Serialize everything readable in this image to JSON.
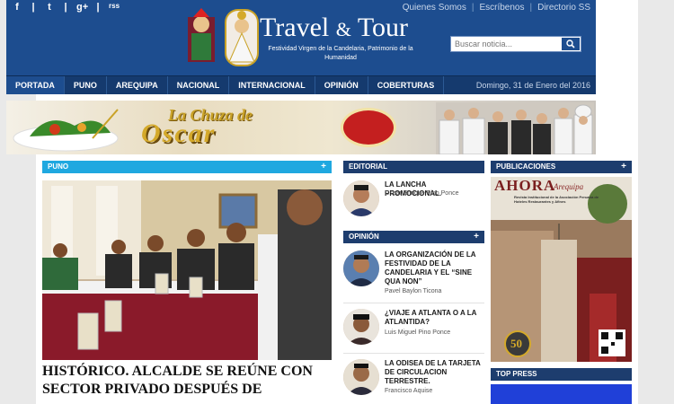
{
  "header": {
    "social_icons": [
      "facebook-icon",
      "twitter-icon",
      "google-plus-icon",
      "rss-icon"
    ],
    "social_glyphs": [
      "f",
      "t",
      "g+",
      "rss"
    ],
    "top_links": [
      "Quienes Somos",
      "Escríbenos",
      "Directorio SS"
    ],
    "brand_main": "Travel",
    "brand_amp": "&",
    "brand_tail": "Tour",
    "tagline": "Festividad Virgen de la Candelaria, Patrimonio de la Humanidad",
    "search_placeholder": "Buscar noticia...",
    "brand_color": "#1d4d8f"
  },
  "nav": {
    "items": [
      "PORTADA",
      "PUNO",
      "AREQUIPA",
      "NACIONAL",
      "INTERNACIONAL",
      "OPINIÓN",
      "COBERTURAS"
    ],
    "active": "PORTADA",
    "date": "Domingo, 31 de Enero del 2016"
  },
  "banner": {
    "line1": "La Chuza de",
    "line2": "Oscar"
  },
  "sections": {
    "puno": "PUNO",
    "editorial": "EDITORIAL",
    "opinion": "OPINIÓN",
    "publicaciones": "PUBLICACIONES",
    "top_press": "TOP PRESS",
    "plus": "+"
  },
  "main_story": {
    "headline": "HISTÓRICO. ALCALDE SE REÚNE CON SECTOR PRIVADO DESPUÉS DE"
  },
  "editorial": {
    "title": "LA LANCHA PROMOCIONAL.",
    "author": "Oscar Enrique Pino Ponce"
  },
  "opinion_items": [
    {
      "title": "LA ORGANIZACIÓN DE LA FESTIVIDAD DE LA CANDELARIA Y EL “SINE QUA NON”",
      "author": "Pavel Baylon Ticona"
    },
    {
      "title": "¿VIAJE A ATLANTA O A LA ATLANTIDA?",
      "author": "Luis Miguel Pino Ponce"
    },
    {
      "title": "LA ODISEA DE LA TARJETA DE CIRCULACION TERRESTRE.",
      "author": "Francisco Aquise"
    }
  ],
  "publication": {
    "name": "AHORA",
    "city": "Arequipa",
    "subtitle": "Revista Institucional de la Asociación Peruana de Hoteles Restaurantes y Afines",
    "badge": "50"
  },
  "colors": {
    "cyan": "#1fa8e0",
    "navy": "#1d3d6e"
  }
}
